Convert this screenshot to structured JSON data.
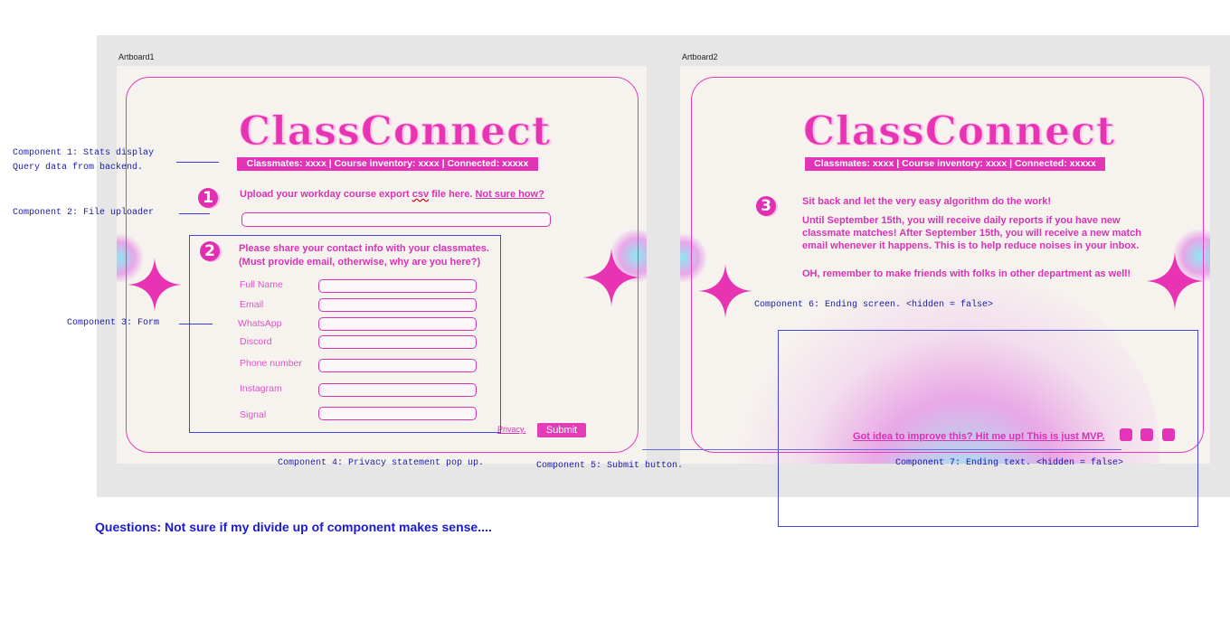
{
  "artboards": {
    "artboard1_label": "Artboard1",
    "artboard2_label": "Artboard2"
  },
  "app": {
    "title": "ClassConnect",
    "stats": "Classmates: xxxx |  Course inventory: xxxx | Connected: xxxxx"
  },
  "upload": {
    "step": "1",
    "text_before": "Upload your workday course export ",
    "text_csv": "csv",
    "text_after": " file here. ",
    "help_link": "Not sure how?",
    "input_value": ""
  },
  "form": {
    "step": "2",
    "heading_line1": "Please share your contact info with your classmates.",
    "heading_line2": "(Must provide email, otherwise, why are you here?)",
    "fields": [
      {
        "label": "Full Name",
        "value": ""
      },
      {
        "label": "Email",
        "value": ""
      },
      {
        "label": "WhatsApp",
        "value": ""
      },
      {
        "label": "Discord",
        "value": ""
      },
      {
        "label": "Phone number",
        "value": ""
      },
      {
        "label": "Instagram",
        "value": ""
      },
      {
        "label": "Signal",
        "value": ""
      }
    ],
    "privacy_label": "Privacy.",
    "submit_label": "Submit"
  },
  "ending": {
    "step": "3",
    "line1": "Sit back and let the very easy algorithm do the work!",
    "para": "Until September 15th, you will receive daily reports if you have new classmate matches! After September 15th, you will receive a new match email whenever it happens. This is to help reduce noises in your inbox.",
    "line3": "OH, remember to make friends with folks in other department as well!",
    "footer_text": "Got idea to improve this? Hit me up!  This is just MVP."
  },
  "annotations": {
    "c1_line1": "Component 1: Stats display",
    "c1_line2": "Query data from backend.",
    "c2": "Component 2: File uploader",
    "c3": "Component 3: Form",
    "c4": "Component 4: Privacy statement pop up.",
    "c5": "Component 5: Submit button.",
    "c6": "Component 6: Ending screen. <hidden = false>",
    "c7": "Component 7: Ending text. <hidden = false>"
  },
  "question": "Questions: Not sure if my divide up of component makes sense....",
  "colors": {
    "brand_pink": "#e234b6",
    "annotation_blue": "#1a1ad0",
    "artboard_bg": "#f6f3ef",
    "canvas_bg": "#e6e6e6"
  }
}
